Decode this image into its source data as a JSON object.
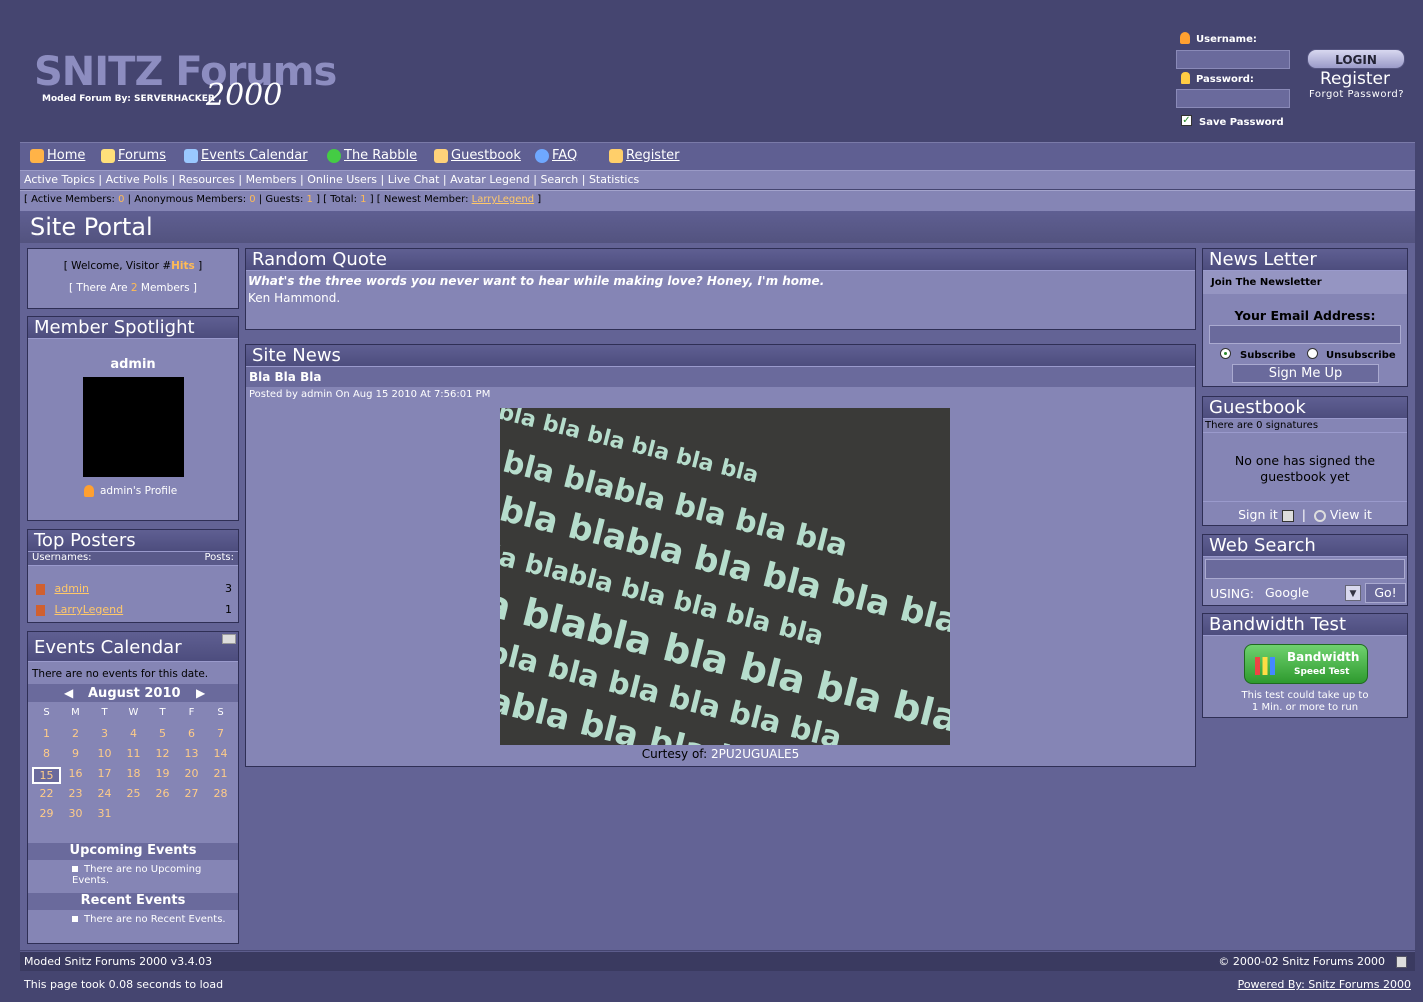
{
  "header": {
    "logo_title": "SNITZ Forums",
    "logo_sub": "Moded Forum By: SERVERHACKER",
    "logo_year": "2000",
    "username_label": "Username:",
    "password_label": "Password:",
    "save_password_label": "Save Password",
    "login_button": "LOGIN",
    "register_link": "Register",
    "forgot_link": "Forgot Password?"
  },
  "nav": {
    "items": [
      {
        "label": "Home",
        "icon": "home-icon",
        "color": "#ffb347"
      },
      {
        "label": "Forums",
        "icon": "forums-icon",
        "color": "#ffe07a"
      },
      {
        "label": "Events Calendar",
        "icon": "calendar-icon",
        "color": "#9ac8ff"
      },
      {
        "label": "The Rabble",
        "icon": "smiley-icon",
        "color": "#44cc44"
      },
      {
        "label": "Guestbook",
        "icon": "pencil-icon",
        "color": "#ffd27a"
      },
      {
        "label": "FAQ",
        "icon": "help-icon",
        "color": "#6fa8ff"
      },
      {
        "label": "Register",
        "icon": "register-icon",
        "color": "#ffcf6a"
      }
    ]
  },
  "subnav": [
    "Active Topics",
    "Active Polls",
    "Resources",
    "Members",
    "Online Users",
    "Live Chat",
    "Avatar Legend",
    "Search",
    "Statistics"
  ],
  "stats": {
    "active_label": "Active Members:",
    "active": "0",
    "anon_label": "Anonymous Members:",
    "anon": "0",
    "guests_label": "Guests:",
    "guests": "1",
    "total_label": "Total:",
    "total": "1",
    "newest_label": "Newest Member:",
    "newest": "LarryLegend"
  },
  "page_title": "Site Portal",
  "welcome": {
    "line1_pre": "[ Welcome, Visitor #",
    "hits": "Hits",
    "line1_post": " ]",
    "line2_pre": "[ There Are ",
    "members": "2",
    "line2_post": " Members ]"
  },
  "spotlight": {
    "title": "Member Spotlight",
    "name": "admin",
    "profile_link": "admin's Profile"
  },
  "top_posters": {
    "title": "Top Posters",
    "col_user": "Usernames:",
    "col_posts": "Posts:",
    "rows": [
      {
        "name": "admin",
        "posts": "3"
      },
      {
        "name": "LarryLegend",
        "posts": "1"
      }
    ]
  },
  "events": {
    "title": "Events Calendar",
    "none_text": "There are no events for this date.",
    "month": "August 2010",
    "dow": [
      "S",
      "M",
      "T",
      "W",
      "T",
      "F",
      "S"
    ],
    "weeks": [
      [
        "1",
        "2",
        "3",
        "4",
        "5",
        "6",
        "7"
      ],
      [
        "8",
        "9",
        "10",
        "11",
        "12",
        "13",
        "14"
      ],
      [
        "15",
        "16",
        "17",
        "18",
        "19",
        "20",
        "21"
      ],
      [
        "22",
        "23",
        "24",
        "25",
        "26",
        "27",
        "28"
      ],
      [
        "29",
        "30",
        "31",
        "",
        "",
        "",
        ""
      ]
    ],
    "today": "15",
    "upcoming_title": "Upcoming Events",
    "upcoming_text": "There are no Upcoming Events.",
    "recent_title": "Recent Events",
    "recent_text": "There are no Recent Events."
  },
  "quote": {
    "title": "Random Quote",
    "text": "What's the three words you never want to hear while making love? Honey, I'm home.",
    "author": "Ken Hammond."
  },
  "news": {
    "title": "Site News",
    "headline": "Bla Bla Bla",
    "posted": "Posted by admin On Aug 15 2010 At 7:56:01 PM",
    "image_words": [
      "bla bla bla bla bla bla bla",
      "bla bla blabla bla bla bla",
      "bla bla blabla bla bla bla bla",
      "bla bla blabla bla bla bla bla",
      "a bla blabla bla bla bla bla bla",
      "la blabla bla bla bla bla bla",
      "bla blabla bla bla bla bla bla",
      "blabla bla bla bla bla bla"
    ],
    "courtesy_label": "Curtesy of:",
    "courtesy": "2PU2UGUALE5"
  },
  "newsletter": {
    "title": "News Letter",
    "join": "Join The Newsletter",
    "email_label": "Your Email Address:",
    "subscribe": "Subscribe",
    "unsubscribe": "Unsubscribe",
    "button": "Sign Me Up"
  },
  "guestbook": {
    "title": "Guestbook",
    "count": "There are 0 signatures",
    "empty": "No one has signed the guestbook yet",
    "sign": "Sign it",
    "sep": "|",
    "view": "View it"
  },
  "websearch": {
    "title": "Web Search",
    "using": "USING:",
    "engine": "Google",
    "go": "Go!"
  },
  "bandwidth": {
    "title": "Bandwidth Test",
    "btn_line1": "Bandwidth",
    "btn_line2": "Speed Test",
    "note_line1": "This test could take up to",
    "note_line2": "1 Min. or more to run"
  },
  "footer": {
    "version": "Moded Snitz Forums 2000 v3.4.03",
    "copyright": "© 2000-02 Snitz Forums 2000",
    "load": "This page took 0.08 seconds to load",
    "powered": "Powered By: Snitz Forums 2000"
  }
}
